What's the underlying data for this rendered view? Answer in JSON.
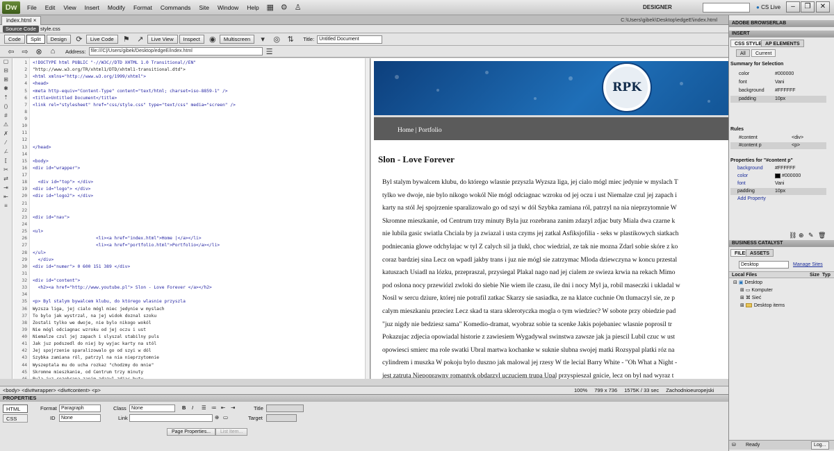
{
  "app": {
    "logo": "Dw",
    "workspace": "DESIGNER",
    "cs_live": "CS Live"
  },
  "menus": [
    "File",
    "Edit",
    "View",
    "Insert",
    "Modify",
    "Format",
    "Commands",
    "Site",
    "Window",
    "Help"
  ],
  "document": {
    "tab": "index.html",
    "path": "C:\\Users\\gibek\\Desktop\\edgeE\\index.html",
    "source_code": "Source Code",
    "related_file": "style.css"
  },
  "toolbar": {
    "code": "Code",
    "split": "Split",
    "design": "Design",
    "live_code": "Live Code",
    "live_view": "Live View",
    "inspect": "Inspect",
    "multiscreen": "Multiscreen",
    "title_label": "Title:",
    "title_value": "Untitled Document"
  },
  "address": {
    "label": "Address:",
    "value": "file:///C|/Users/gibek/Desktop/edgeE/index.html"
  },
  "code_lines": [
    "<!DOCTYPE html PUBLIC \"-//W3C//DTD XHTML 1.0 Transitional//EN\"",
    "\"http://www.w3.org/TR/xhtml1/DTD/xhtml1-transitional.dtd\">",
    "<html xmlns=\"http://www.w3.org/1999/xhtml\">",
    "<head>",
    "<meta http-equiv=\"Content-Type\" content=\"text/html; charset=iso-8859-1\" />",
    "<title>Untitled Document</title>",
    "<link rel=\"stylesheet\" href=\"css/style.css\" type=\"text/css\" media=\"screen\" />",
    "",
    "",
    "",
    "",
    "",
    "</head>",
    "",
    "<body>",
    "<div id=\"wrapper\">",
    "",
    "  <div id=\"top\"> </div>",
    "<div id=\"logo\"> </div>",
    "<div id=\"logo2\"> </div>",
    "",
    "",
    "<div id=\"nav\">",
    "",
    "<ul>",
    "                        <li><a href=\"index.html\">Home |</a></li>",
    "                        <li><a href=\"portfolio.html\">Portfolio</a></li>",
    "</ul>",
    "  </div>",
    "<div id=\"numer\"> 0 600 151 389 </div>",
    "",
    "<div id=\"content\">",
    "  <h2><a href=\"http://www.youtube.pl\"> Slon - Love Forever </a></h2>",
    "",
    "<p> Byl stalym bywalcem klubu, do którego wlasnie przyszla",
    "Wyzsza liga, jej cialo mógl miec jedynie w myslach",
    "To bylo jak wystrzal, na jej widok doznal szoku",
    "Zostali tylko we dwoje, nie bylo nikogo wokól",
    "Nie mógl odciagnac wzroku od jej oczu i ust",
    "Niemalze czul jej zapach i slyszal stabilny puls",
    "Jak juz podszedl do niej by wyjac karty na stól",
    "Jej spojrzenie sparalizowalo go od szyi w dól",
    "Szybka zamiana ról, patrzyl na nia nieprzytomnie",
    "Wyszeptala mu do ucha rozkaz \"chodzmy do mnie\"",
    "Skromne mieszkanie, od Centrum trzy minuty",
    "Byla juz rozebrana zanim zdazyl zdjac buty",
    "Miala dwa czarne kruki wydziarane na lopatkach"
  ],
  "design": {
    "nav": "Home | Portfolio",
    "seal_text": "RPK",
    "heading": "Slon - Love Forever",
    "paragraph_lines": [
      "Byl stalym bywalcem klubu, do którego wlasnie przyszla Wyzsza liga, jej cialo mógl miec jedynie w myslach T",
      "tylko we dwoje, nie bylo nikogo wokól Nie mógl odciagnac wzroku od jej oczu i ust Niemalze czul jej zapach i",
      "karty na stól Jej spojrzenie sparalizowalo go od szyi w dól Szybka zamiana ról, patrzyl na nia nieprzytomnie W",
      "Skromne mieszkanie, od Centrum trzy minuty Byla juz rozebrana zanim zdazyl zdjac buty Miala dwa czarne k",
      "nie lubila gasic swiatla Chciala by ja zwiazal i usta czyms jej zatkal Asfiksjofilia - seks w plastikowych siatkach",
      "podniecania glowe odchylajac w tyl Z calych sil ja tlukl, choc wiedzial, ze tak nie mozna Zdarl sobie skóre z ko",
      "coraz bardziej sina Lecz on wpadl jakby trans i juz nie mógl sie zatrzymac Mloda dziewczyna w koncu przestal",
      "katuszach Usiadl na lózku, przepraszal, przysiegal Plakal nago nad jej cialem ze swieza krwia na rekach Mimo",
      "pod oslona nocy przewiózl zwloki do siebie Nie wiem ile czasu, ile dni i nocy Myl ja, robil maseczki i ukladal w",
      "Nosil w sercu dziure, której nie potrafil zatkac Skarzy sie sasiadka, ze na klatce cuchnie On tlumaczyl sie, ze p",
      "calym mieszkaniu przeciez Lecz skad ta stara sklerotyczka mogla o tym wiedziec? W sobote przy obiedzie pad",
      "\"juz nigdy nie bedziesz sama\" Komedio-dramat, wyobraz sobie ta scenke Jakis pojebaniec wlasnie poprosil tr",
      "Pokazujac zdjecia opowiadal historie z zawiesiem Wygadywal swinstwa zawsze jak ja piescil Lubil czuc w ust",
      "opowiesci smierc ma role swatki Ubral martwa kochanke w suknie slubna swojej matki Rozsypal platki róz na",
      "cylindrem i muszka W pokoju bylo duszno jak malowal jej rzesy W tle lecial Barry White - \"Oh What a Night -",
      "jest zatruta Niepoprawny romantyk obdarzyl uczuciem trupa Upal przyspieszal gnicie, lecz on byl nad wyraz t"
    ]
  },
  "status": {
    "tags": "<body> <div#wrapper> <div#content> <p>",
    "zoom": "100%",
    "size": "799 x 736",
    "weight": "1575K / 33 sec",
    "encoding": "Zachodnioeuropejski"
  },
  "properties": {
    "header": "PROPERTIES",
    "html_btn": "HTML",
    "css_btn": "CSS",
    "format_label": "Format",
    "format_value": "Paragraph",
    "id_label": "ID",
    "id_value": "None",
    "class_label": "Class",
    "class_value": "None",
    "link_label": "Link",
    "link_value": "",
    "title_label": "Title",
    "target_label": "Target",
    "bold": "B",
    "italic": "I",
    "page_properties": "Page Properties...",
    "list_item": "List Item..."
  },
  "panels": {
    "browserlab": "ADOBE BROWSERLAB",
    "insert": "INSERT",
    "css_styles": "CSS STYLES",
    "ap_elements": "AP ELEMENTS",
    "all": "All",
    "current": "Current",
    "summary_title": "Summary for Selection",
    "summary": [
      {
        "k": "color",
        "v": "#000000"
      },
      {
        "k": "font",
        "v": "Vani"
      },
      {
        "k": "background",
        "v": "#FFFFFF"
      },
      {
        "k": "padding",
        "v": "10px"
      }
    ],
    "rules_title": "Rules",
    "rules": [
      {
        "k": "#content",
        "v": "<div>"
      },
      {
        "k": "#content p",
        "v": "<p>"
      }
    ],
    "props_title": "Properties for \"#content p\"",
    "props": [
      {
        "k": "background",
        "v": "#FFFFFF"
      },
      {
        "k": "color",
        "v": "#000000"
      },
      {
        "k": "font",
        "v": "Vani"
      },
      {
        "k": "padding",
        "v": "10px"
      }
    ],
    "add_property": "Add Property",
    "business_catalyst": "BUSINESS CATALYST",
    "files": "FILES",
    "assets": "ASSETS",
    "site_select": "Desktop",
    "manage_sites": "Manage Sites",
    "local_files": "Local Files",
    "size_col": "Size",
    "type_col": "Typ",
    "tree": [
      "Desktop",
      "Komputer",
      "Sieć",
      "Desktop items"
    ],
    "ready": "Ready",
    "log": "Log..."
  },
  "colors": {
    "accent": "#1f6fb8",
    "banner_dark": "#0d3f7c"
  }
}
